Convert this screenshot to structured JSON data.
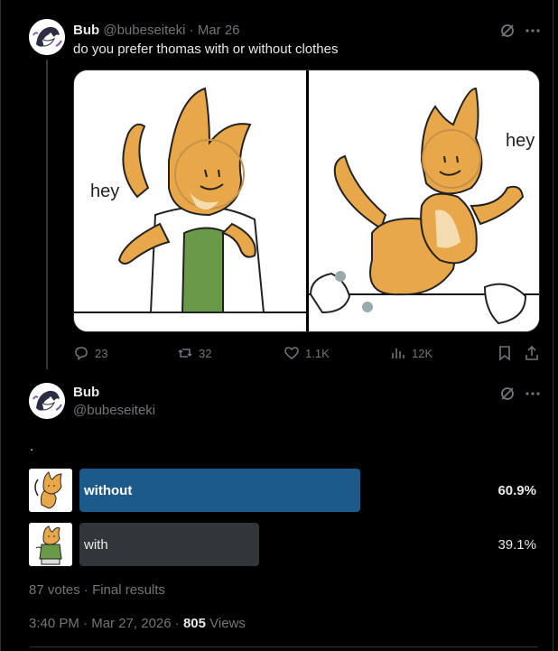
{
  "reply_tweet": {
    "display_name": "Bub",
    "handle": "@bubeseiteki",
    "separator": "·",
    "date": "Mar 26",
    "text": "do you prefer thomas with or without clothes",
    "media": {
      "left_speech": "hey",
      "right_speech": "hey"
    },
    "actions": {
      "replies": "23",
      "reposts": "32",
      "likes": "1.1K",
      "views": "12K"
    }
  },
  "main_tweet": {
    "display_name": "Bub",
    "handle": "@bubeseiteki",
    "text": ".",
    "poll": {
      "options": [
        {
          "label": "without",
          "percent": "60.9%",
          "share": 0.609,
          "winner": true
        },
        {
          "label": "with",
          "percent": "39.1%",
          "share": 0.391,
          "winner": false
        }
      ],
      "votes": "87 votes",
      "separator": "·",
      "status": "Final results"
    },
    "timestamp": {
      "time": "3:40 PM",
      "separator": "·",
      "date": "Mar 27, 2026",
      "separator2": "·",
      "views_count": "805",
      "views_label": "Views"
    }
  },
  "colors": {
    "background": "#000000",
    "winner_bar": "#1d5a8c",
    "loser_bar": "#333639",
    "muted_text": "#71767b",
    "primary_text": "#e7e9ea",
    "character_orange": "#e8a84a",
    "shirt_green": "#6a9a48"
  },
  "icons": [
    "grok-icon",
    "more-icon",
    "reply-icon",
    "repost-icon",
    "like-icon",
    "views-icon",
    "bookmark-icon",
    "share-icon"
  ]
}
